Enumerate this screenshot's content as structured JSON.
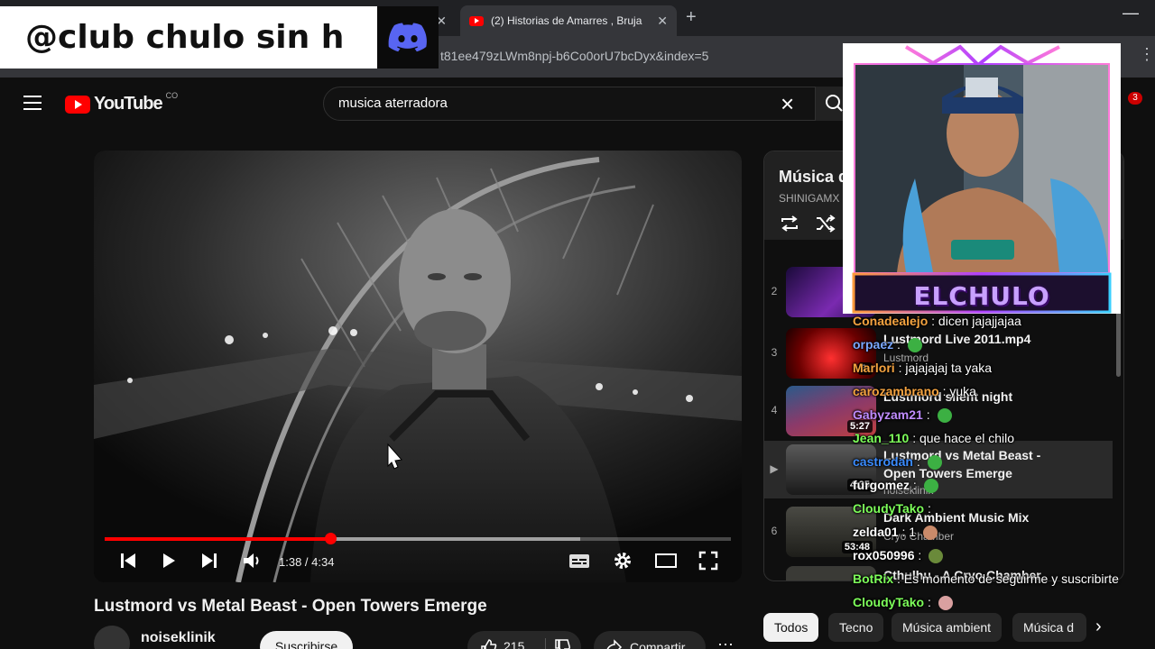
{
  "overlay": {
    "handle": "@club chulo sin h",
    "webcam_name": "ELCHULO"
  },
  "browser": {
    "tabs": [
      {
        "title": ""
      },
      {
        "title": "(2) Historias de Amarres , Bruja"
      }
    ],
    "url": "t81ee479zLWm8npj-b6Co0orU7bcDyx&index=5"
  },
  "youtube": {
    "logo_text": "YouTube",
    "country_code": "CO",
    "search_value": "musica aterradora",
    "notification_count": "3"
  },
  "player": {
    "time": "1:38 / 4:34",
    "progress_fraction": 0.36,
    "buffer_fraction": 0.76
  },
  "video": {
    "title": "Lustmord vs Metal Beast - Open Towers Emerge",
    "channel": "noiseklinik",
    "subscribe_label": "Suscribirse",
    "likes": "215",
    "share_label": "Compartir"
  },
  "playlist": {
    "title": "Música d",
    "owner": "SHINIGAMX -",
    "items": [
      {
        "index": "2",
        "title": "",
        "channel": "",
        "duration": ""
      },
      {
        "index": "3",
        "title": "Lustmord Live 2011.mp4",
        "channel": "Lustmord",
        "duration": "3:"
      },
      {
        "index": "4",
        "title": "Lustmord silent night",
        "channel": "",
        "duration": "5:27"
      },
      {
        "index": "▶",
        "title": "Lustmord vs Metal Beast - Open Towers Emerge",
        "channel": "noiseklinik",
        "duration": "4:35"
      },
      {
        "index": "6",
        "title": "Dark Ambient Music Mix",
        "channel": "Cryo Chamber",
        "duration": "53:48"
      },
      {
        "index": "",
        "title": "Cthulhu - A Cryo Chamber",
        "channel": "",
        "duration": ""
      }
    ]
  },
  "chips": [
    "Todos",
    "Tecno",
    "Música ambient",
    "Música d"
  ],
  "chat": [
    {
      "user": "Conadealejo",
      "color": "#f4a340",
      "text": ": dicen jajajjajaa",
      "emote": ""
    },
    {
      "user": "orpaez",
      "color": "#7aa7ff",
      "text": ":",
      "emote": "#3cb043"
    },
    {
      "user": "Marlori",
      "color": "#f4a340",
      "text": ": jajajajaj ta yaka",
      "emote": ""
    },
    {
      "user": "carozambrano",
      "color": "#f4a340",
      "text": ": yuka",
      "emote": ""
    },
    {
      "user": "Gabyzam21",
      "color": "#c08cff",
      "text": ":",
      "emote": "#3cb043"
    },
    {
      "user": "Jean_110",
      "color": "#7dff5a",
      "text": ": que hace el chilo",
      "emote": ""
    },
    {
      "user": "castrodan",
      "color": "#3b8cff",
      "text": ":",
      "emote": "#3cb043"
    },
    {
      "user": "furgomez",
      "color": "#ffffff",
      "text": ":",
      "emote": "#3cb043"
    },
    {
      "user": "CloudyTako",
      "color": "#7dff5a",
      "text": ":",
      "emote": ""
    },
    {
      "user": "zelda01",
      "color": "#ffffff",
      "text": ": 1",
      "emote": "#c98a6a"
    },
    {
      "user": "rox050996",
      "color": "#ffffff",
      "text": ":",
      "emote": "#6a8a3a"
    },
    {
      "user": "BotRix",
      "color": "#7dff5a",
      "text": ": Es momento de seguirme y suscribirte",
      "emote": ""
    },
    {
      "user": "CloudyTako",
      "color": "#7dff5a",
      "text": ":",
      "emote": "#d9a0a0"
    }
  ],
  "colors": {
    "accent": "#ff0000",
    "background": "#0f0f0f",
    "surface": "#272727"
  }
}
